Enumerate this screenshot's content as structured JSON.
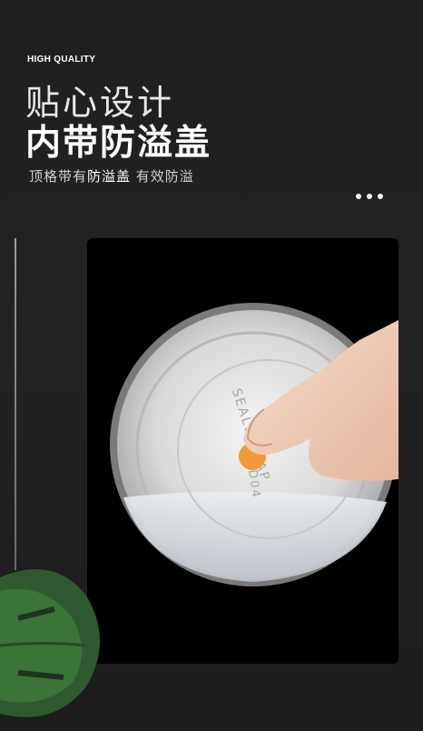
{
  "header": {
    "badge": "HIGH QUALITY",
    "title_line1": "贴心设计",
    "title_line2": "内带防溢盖",
    "subtitle_pre": "顶格带有",
    "subtitle_highlight": "防溢盖",
    "subtitle_post": " 有效防溢"
  },
  "photo": {
    "lid_text": "SEALED CAP",
    "lid_number": "D04",
    "accent_color": "#f29a3a"
  },
  "icons": [
    "more-dots-icon",
    "leaf-icon"
  ]
}
